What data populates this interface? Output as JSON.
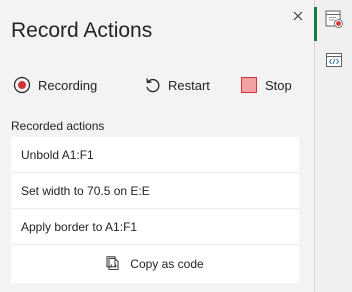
{
  "pane": {
    "title": "Record Actions"
  },
  "toolbar": {
    "recording_label": "Recording",
    "restart_label": "Restart",
    "stop_label": "Stop"
  },
  "recorded": {
    "section_label": "Recorded actions",
    "items": [
      {
        "label": "Unbold A1:F1"
      },
      {
        "label": "Set width to 70.5 on E:E"
      },
      {
        "label": "Apply border to A1:F1"
      }
    ],
    "copy_label": "Copy as code"
  },
  "rail": {
    "items": [
      {
        "icon": "record-actions-icon",
        "active": true
      },
      {
        "icon": "code-editor-icon",
        "active": false
      }
    ]
  },
  "colors": {
    "record_red": "#d13438",
    "stop_fill": "#f1a1a3",
    "active_green": "#107c41"
  }
}
